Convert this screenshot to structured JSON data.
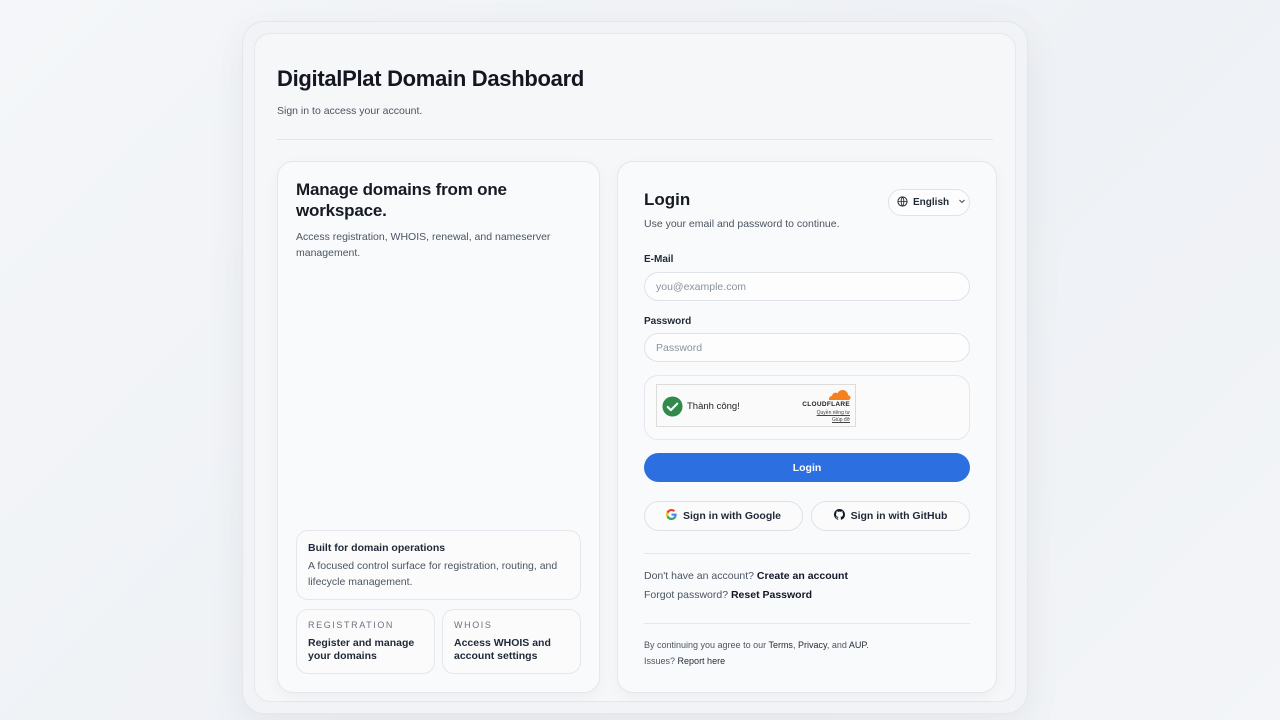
{
  "header": {
    "title": "DigitalPlat Domain Dashboard",
    "subtitle": "Sign in to access your account."
  },
  "left_panel": {
    "heading": "Manage domains from one workspace.",
    "description": "Access registration, WHOIS, renewal, and nameserver management.",
    "feature": {
      "title": "Built for domain operations",
      "description": "A focused control surface for registration, routing, and lifecycle management."
    },
    "cards": [
      {
        "label": "REGISTRATION",
        "text": "Register and manage your domains"
      },
      {
        "label": "WHOIS",
        "text": "Access WHOIS and account settings"
      }
    ]
  },
  "login": {
    "title": "Login",
    "subtitle": "Use your email and password to continue.",
    "language": "English",
    "email_label": "E-Mail",
    "email_placeholder": "you@example.com",
    "email_value": "",
    "password_label": "Password",
    "password_placeholder": "Password",
    "password_value": "",
    "captcha": {
      "status_text": "Thành công!",
      "brand": "CLOUDFLARE",
      "privacy_link": "Quyền riêng tư",
      "help_link": "Giúp đỡ"
    },
    "submit_label": "Login",
    "google_label": "Sign in with Google",
    "github_label": "Sign in with GitHub",
    "signup_prompt": "Don't have an account?",
    "signup_link": "Create an account",
    "forgot_prompt": "Forgot password?",
    "forgot_link": "Reset Password",
    "legal": {
      "prefix": "By continuing you agree to our",
      "terms": "Terms",
      "comma": ",",
      "privacy": "Privacy",
      "and": ", and",
      "aup": "AUP",
      "period": ".",
      "issues_prefix": "Issues?",
      "report": "Report here"
    }
  },
  "colors": {
    "primary_button": "#2b6fe0",
    "success_check": "#2f8a4b",
    "cloudflare_orange": "#f48120"
  },
  "icons": {
    "language": "globe-icon",
    "chevron": "chevron-down-icon",
    "captcha_success": "check-circle-icon",
    "cloudflare": "cloudflare-cloud-icon",
    "google": "google-g-icon",
    "github": "github-icon"
  }
}
